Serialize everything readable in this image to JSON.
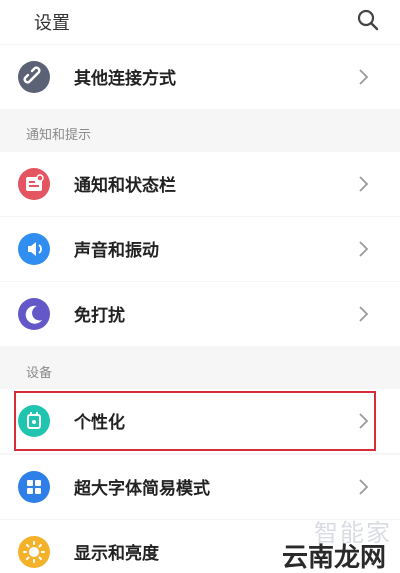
{
  "header": {
    "title": "设置",
    "search_icon": "search-icon"
  },
  "sections": {
    "notifications_label": "通知和提示",
    "device_label": "设备"
  },
  "items": [
    {
      "label": "其他连接方式",
      "icon": "link-icon",
      "color": "#5b6275"
    },
    {
      "label": "通知和状态栏",
      "icon": "notification-icon",
      "color": "#e45461"
    },
    {
      "label": "声音和振动",
      "icon": "speaker-icon",
      "color": "#2f8ef0"
    },
    {
      "label": "免打扰",
      "icon": "moon-icon",
      "color": "#6457c8"
    },
    {
      "label": "个性化",
      "icon": "personalize-icon",
      "color": "#21c4ae",
      "highlighted": true
    },
    {
      "label": "超大字体简易模式",
      "icon": "grid-icon",
      "color": "#2f7fe8"
    },
    {
      "label": "显示和亮度",
      "icon": "sun-icon",
      "color": "#f3b229"
    }
  ],
  "watermark": {
    "top": "智能家",
    "bottom": "云南龙网"
  },
  "colors": {
    "highlight_border": "#d62d3a",
    "background": "#f6f6f6"
  }
}
